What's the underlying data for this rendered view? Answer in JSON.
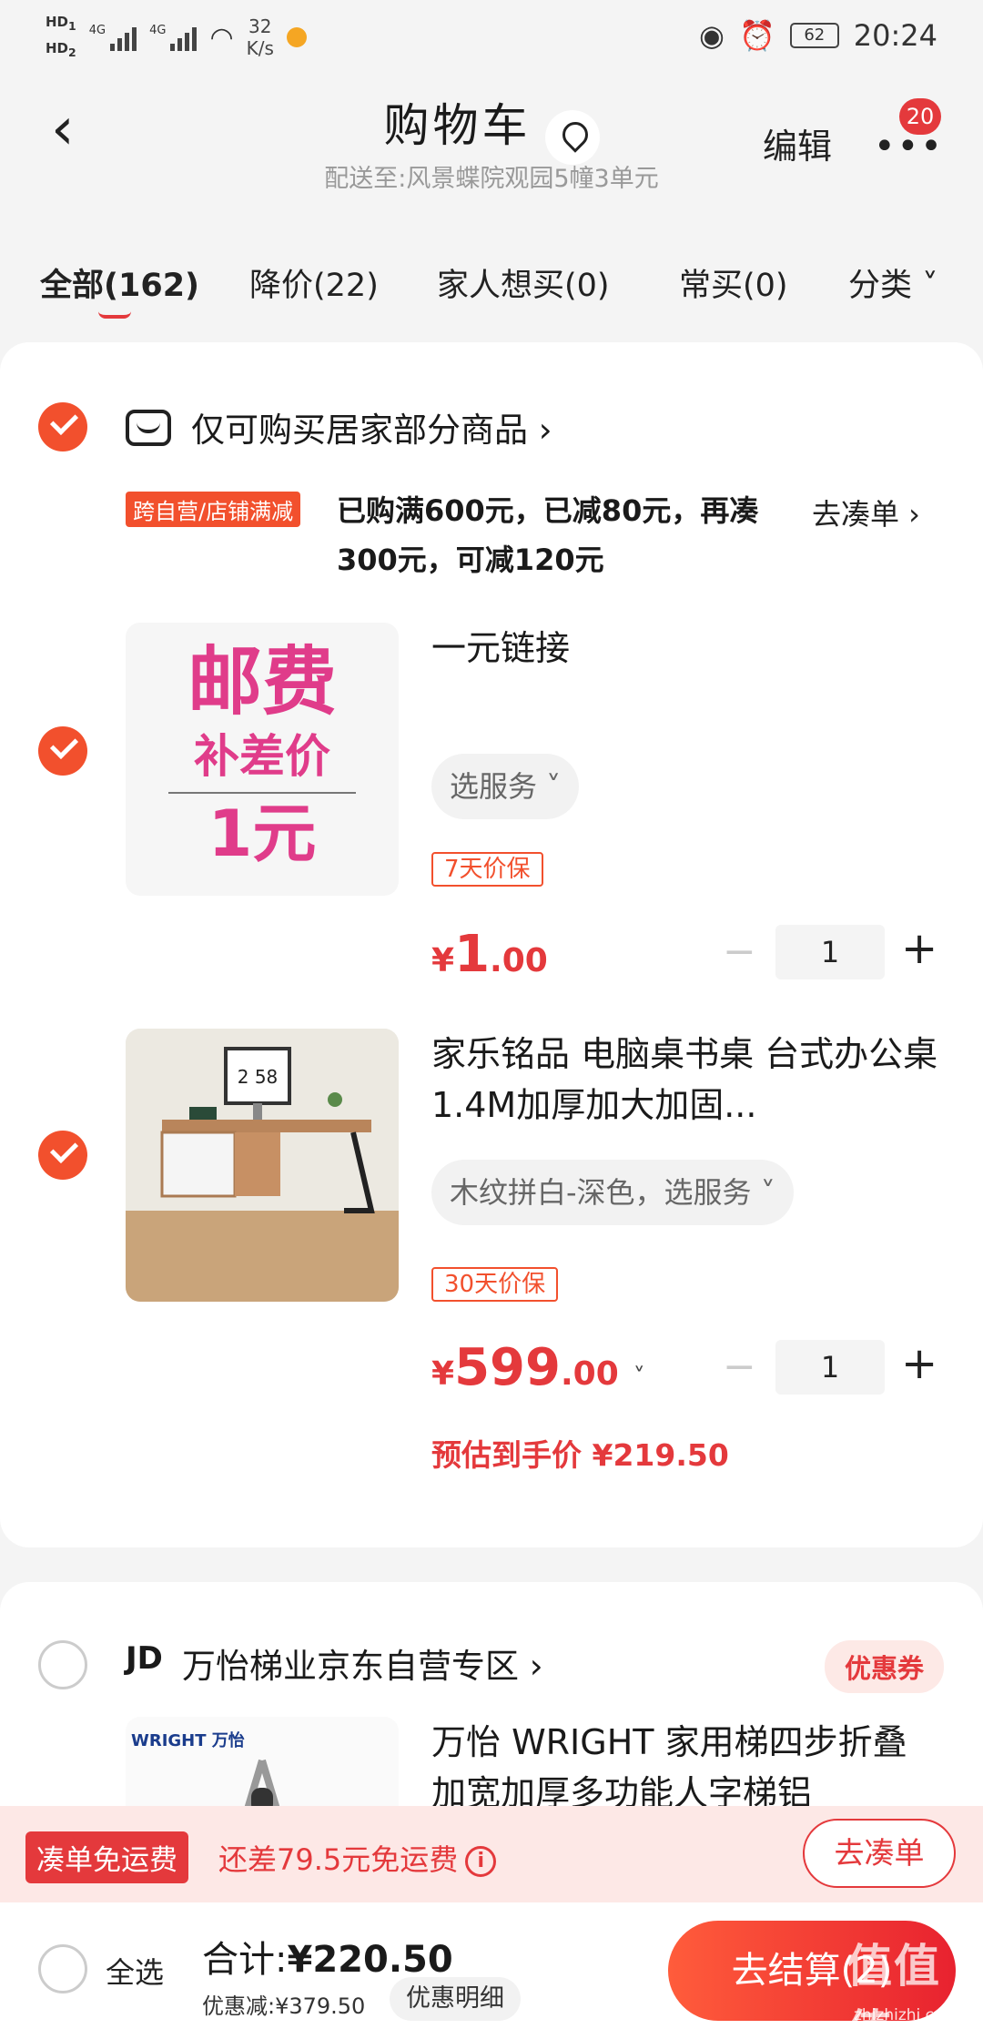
{
  "status_bar": {
    "hd1": "HD",
    "hd1_sub": "1",
    "hd2": "HD",
    "hd2_sub": "2",
    "net1": "4G",
    "net2": "4G",
    "speed_value": "32",
    "speed_unit": "K/s",
    "battery": "62",
    "time": "20:24"
  },
  "header": {
    "title": "购物车",
    "address": "配送至:风景蝶院观园5幢3单元",
    "edit_label": "编辑",
    "more_glyph": "•••",
    "message_badge": "20"
  },
  "tabs": [
    {
      "label": "全部(162)"
    },
    {
      "label": "降价(22)"
    },
    {
      "label": "家人想买(0)"
    },
    {
      "label": "常买(0)"
    },
    {
      "label": "分类 ˅"
    }
  ],
  "store1": {
    "name": "仅可购买居家部分商品 ›",
    "promo_tag": "跨自营/店铺满减",
    "promo_text": "已购满600元，已减80元，再凑300元，可减120元",
    "promo_action": "去凑单 ›",
    "items": [
      {
        "thumb_line1": "邮费",
        "thumb_line2": "补差价",
        "thumb_line3": "1元",
        "name": "一元链接",
        "service": "选服务 ˅",
        "guarantee": "7天价保",
        "price_symbol": "¥",
        "price_int": "1",
        "price_dec": ".00",
        "quantity": "1"
      },
      {
        "name": "家乐铭品 电脑桌书桌 台式办公桌1.4M加厚加大加固...",
        "service": "木纹拼白-深色，选服务 ˅",
        "guarantee": "30天价保",
        "price_symbol": "¥",
        "price_int": "599",
        "price_dec": ".00",
        "price_caret": "˅",
        "quantity": "1",
        "estimated_label": "预估到手价 ¥219.50",
        "monitor_clock": "2 58"
      }
    ]
  },
  "store2": {
    "brand": "JD",
    "name": "万怡梯业京东自营专区 ›",
    "coupon": "优惠券",
    "item_name": "万怡 WRIGHT 家用梯四步折叠加宽加厚多功能人字梯铝",
    "thumb_logo": "WRIGHT 万怡"
  },
  "shipping_bar": {
    "tag": "凑单免运费",
    "text": "还差79.5元免运费",
    "info_glyph": "i",
    "action": "去凑单"
  },
  "checkout": {
    "select_all": "全选",
    "total_label": "合计:",
    "total_amount": "¥220.50",
    "saved": "优惠减:¥379.50",
    "detail": "优惠明细",
    "pay": "去结算(2)"
  },
  "watermark": {
    "mark": "值值值",
    "site": "zhizhizhi.com"
  },
  "icons": {
    "back": "chevron-left-icon",
    "location": "location-pin-icon",
    "more": "more-dots-icon",
    "store": "store-icon",
    "check": "checkmark-icon",
    "info": "info-icon"
  },
  "colors": {
    "accent": "#e4393c",
    "check": "#f2502d",
    "promo_pink": "#e03c8a"
  }
}
